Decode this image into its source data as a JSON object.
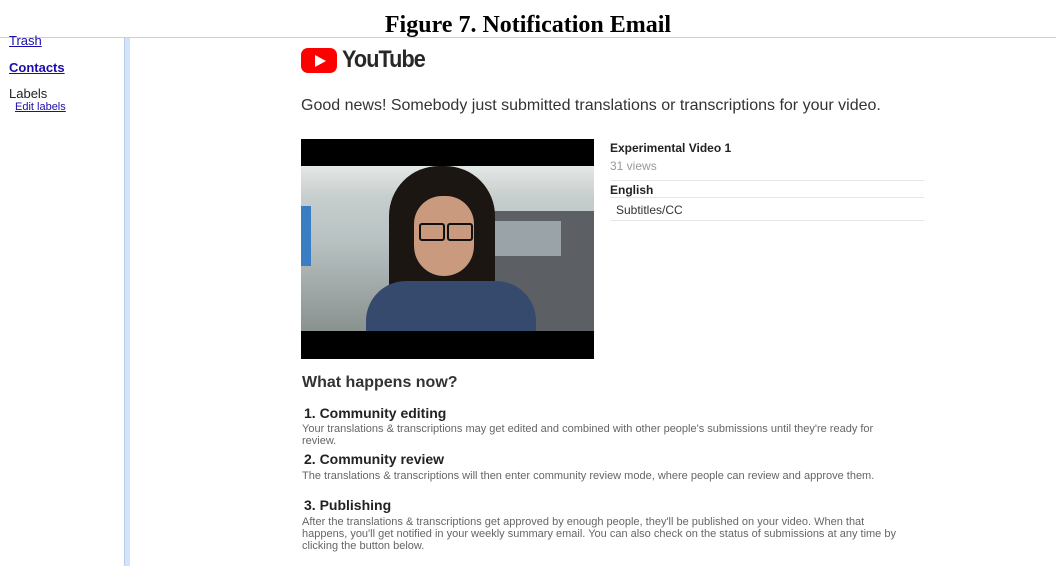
{
  "caption": "Figure 7. Notification Email",
  "sidebar": {
    "trash": "Trash",
    "contacts": "Contacts",
    "labels": "Labels",
    "edit_labels": "Edit labels"
  },
  "logo": {
    "word": "YouTube",
    "brand_color": "#ff0000"
  },
  "email": {
    "intro": "Good news! Somebody just submitted translations or transcriptions for your video.",
    "video": {
      "title": "Experimental Video 1",
      "views": "31 views",
      "language": "English",
      "track": "Subtitles/CC"
    },
    "what_heading": "What happens now?",
    "steps": [
      {
        "heading": "1. Community editing",
        "text": "Your translations & transcriptions may get edited and combined with other people's submissions until they're ready for review."
      },
      {
        "heading": "2. Community review",
        "text": "The translations & transcriptions will then enter community review mode, where people can review and approve them."
      },
      {
        "heading": "3. Publishing",
        "text": "After the translations & transcriptions get approved by enough people, they'll be published on your video. When that happens, you'll get notified in your weekly summary email. You can also check on the status of submissions at any time by clicking the button below."
      }
    ]
  }
}
